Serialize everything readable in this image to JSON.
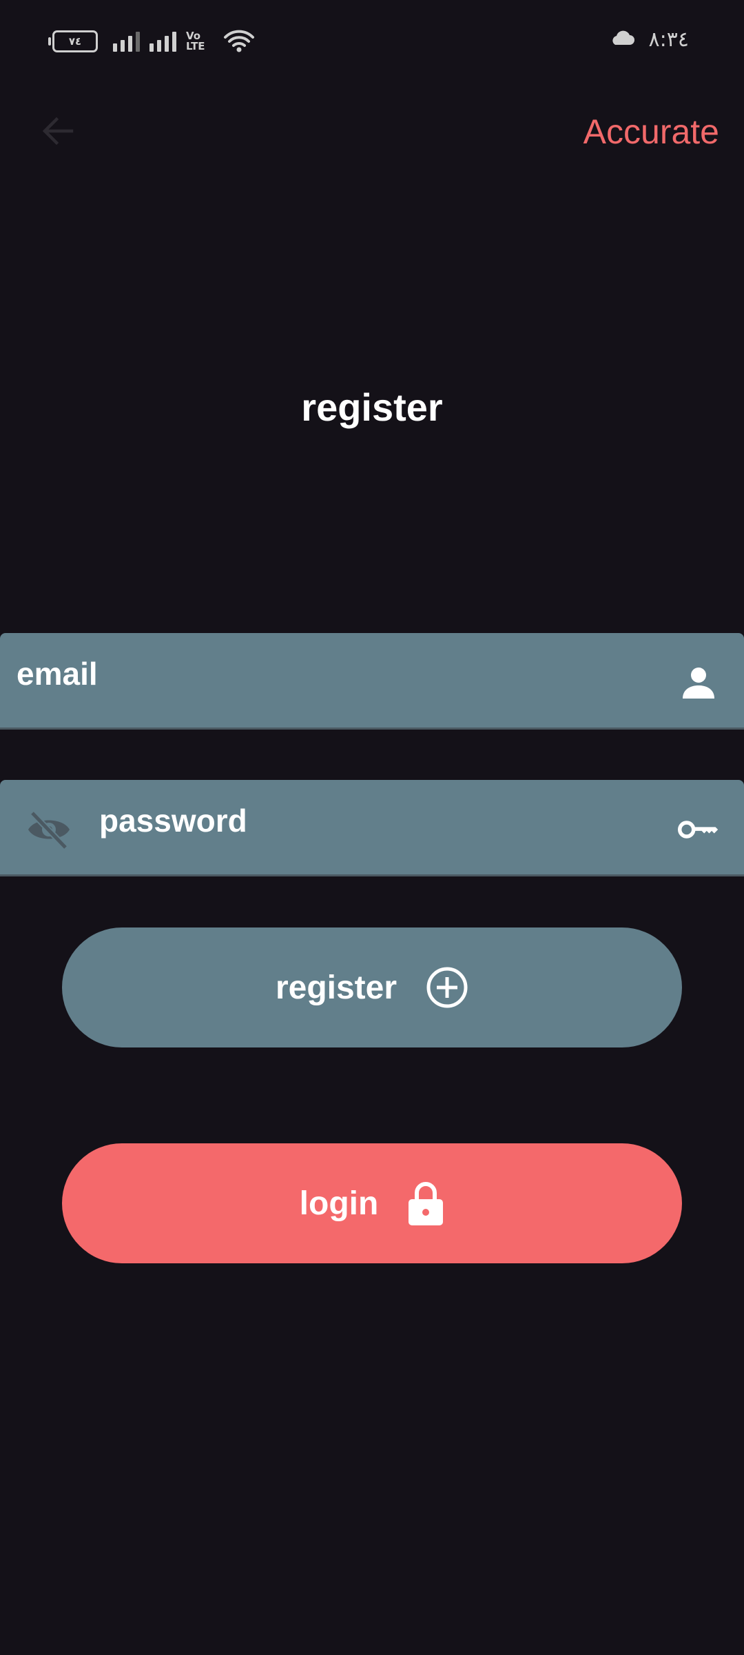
{
  "status_bar": {
    "battery_level": "٧٤",
    "volte_label": "Vo LTE",
    "time": "٨:٣٤"
  },
  "app_bar": {
    "title": "Accurate"
  },
  "page": {
    "title": "register"
  },
  "form": {
    "email_label": "email",
    "password_label": "password"
  },
  "buttons": {
    "register_label": "register",
    "login_label": "login"
  },
  "colors": {
    "background": "#141118",
    "accent": "#f1696a",
    "field_background": "#627f8b",
    "login_button": "#f4696b",
    "register_button": "#627f8b"
  },
  "icons": {
    "back": "arrow-back-icon",
    "email": "person-icon",
    "password": "key-icon",
    "visibility": "eye-off-icon",
    "register": "add-circle-icon",
    "login": "lock-icon",
    "weather": "cloud-icon"
  }
}
